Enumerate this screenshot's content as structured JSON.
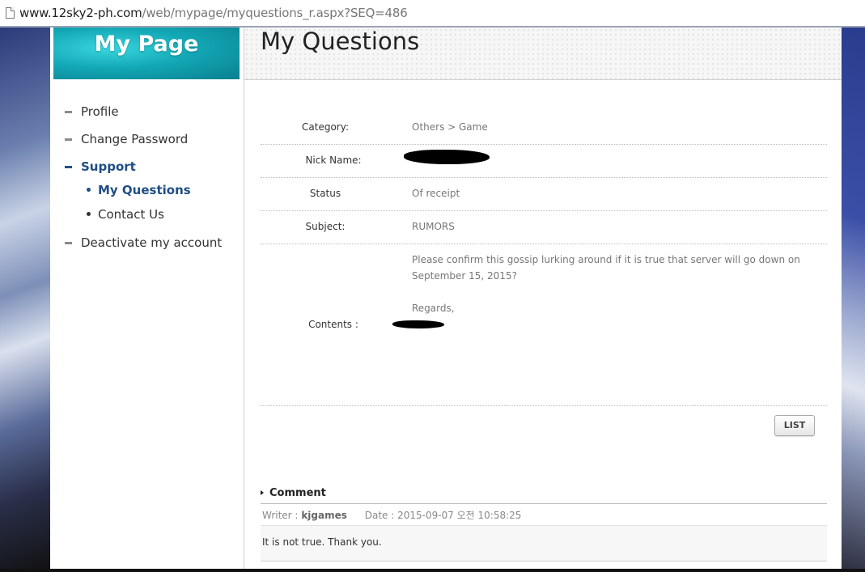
{
  "browser": {
    "url_host": "www.12sky2-ph.com",
    "url_path": "/web/mypage/myquestions_r.aspx?SEQ=486"
  },
  "sidebar": {
    "banner_title": "My Page",
    "items": [
      {
        "label": "Profile"
      },
      {
        "label": "Change Password"
      },
      {
        "label": "Support",
        "active": true,
        "children": [
          {
            "label": "My Questions",
            "active": true
          },
          {
            "label": "Contact Us"
          }
        ]
      },
      {
        "label": "Deactivate my account"
      }
    ]
  },
  "main": {
    "title": "My Questions",
    "fields": {
      "category_label": "Category:",
      "category_value": "Others > Game",
      "nickname_label": "Nick Name:",
      "status_label": "Status",
      "status_value": "Of receipt",
      "subject_label": "Subject:",
      "subject_value": "RUMORS",
      "contents_label": "Contents :",
      "contents_line1": "Please confirm this gossip lurking around if it is true that server will go down on",
      "contents_line2": "September 15, 2015?",
      "contents_line3": "Regards,"
    },
    "list_button": "LIST",
    "comment": {
      "heading": "Comment",
      "writer_label": "Writer :",
      "writer": "kjgames",
      "date_label": "Date :",
      "date": "2015-09-07 오전 10:58:25",
      "body": "It is not true. Thank you."
    }
  }
}
